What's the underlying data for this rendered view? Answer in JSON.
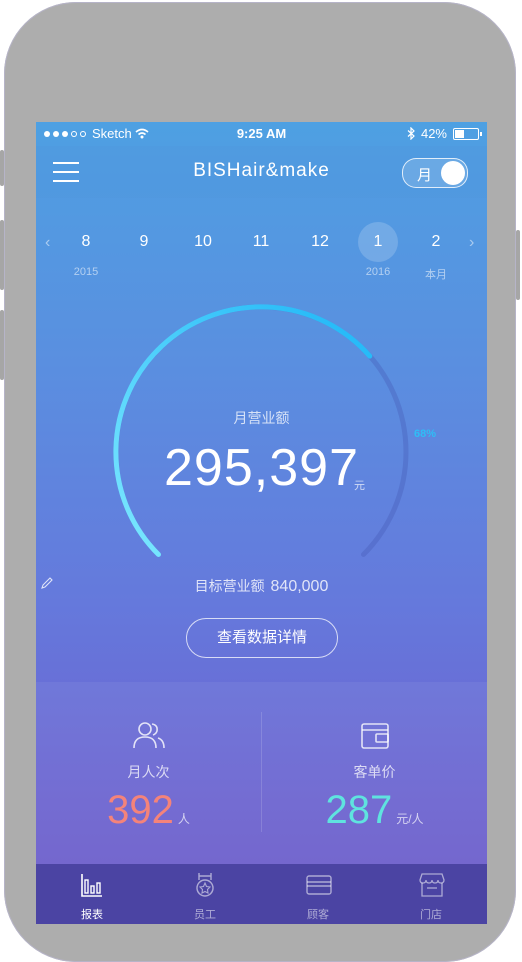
{
  "status": {
    "carrier": "Sketch",
    "time": "9:25 AM",
    "battery": "42%"
  },
  "nav": {
    "title": "BISHair&make",
    "toggle_label": "月"
  },
  "months": [
    {
      "num": "8",
      "sub": "2015"
    },
    {
      "num": "9",
      "sub": ""
    },
    {
      "num": "10",
      "sub": ""
    },
    {
      "num": "11",
      "sub": ""
    },
    {
      "num": "12",
      "sub": ""
    },
    {
      "num": "1",
      "sub": "2016",
      "active": true
    },
    {
      "num": "2",
      "sub": "本月"
    }
  ],
  "gauge": {
    "label": "月营业额",
    "value": "295,397",
    "unit": "元",
    "percent": "68%",
    "progress": 0.68,
    "target_label": "目标营业额",
    "target_value": "840,000"
  },
  "detail_button": "查看数据详情",
  "stats": {
    "visits": {
      "label": "月人次",
      "value": "392",
      "unit": "人"
    },
    "price": {
      "label": "客单价",
      "value": "287",
      "unit": "元/人"
    }
  },
  "tabs": [
    {
      "label": "报表"
    },
    {
      "label": "员工"
    },
    {
      "label": "顾客"
    },
    {
      "label": "门店"
    }
  ],
  "colors": {
    "gauge_start": "#7de8ff",
    "gauge_end": "#1eb6f7",
    "visits_value": "#f4837a",
    "price_value": "#5fe3df",
    "tabbar": "#4b44a3"
  },
  "icons": {
    "menu": "hamburger-menu-icon",
    "edit": "pencil-icon",
    "visits": "users-icon",
    "price": "wallet-icon",
    "tab_report": "bar-chart-icon",
    "tab_staff": "medal-icon",
    "tab_customer": "card-icon",
    "tab_store": "store-icon"
  }
}
